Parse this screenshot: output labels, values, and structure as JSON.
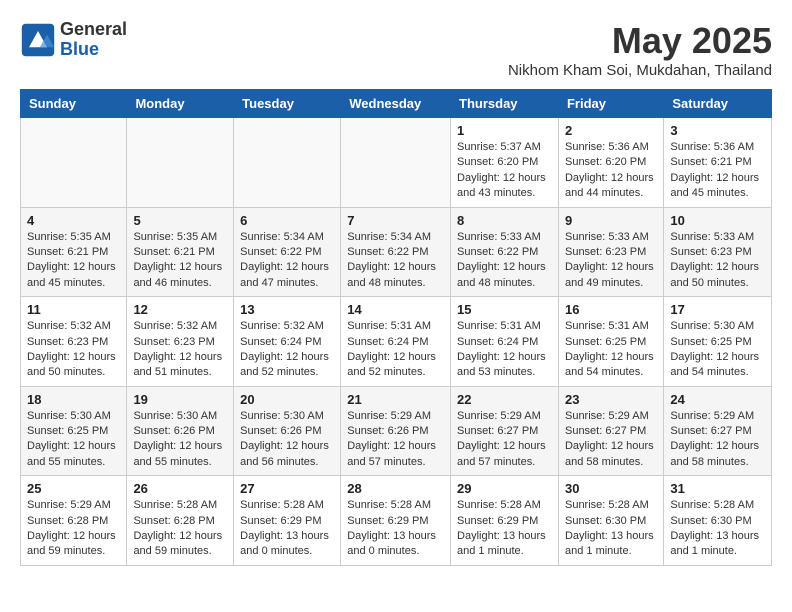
{
  "header": {
    "logo_general": "General",
    "logo_blue": "Blue",
    "month_year": "May 2025",
    "location": "Nikhom Kham Soi, Mukdahan, Thailand"
  },
  "days_of_week": [
    "Sunday",
    "Monday",
    "Tuesday",
    "Wednesday",
    "Thursday",
    "Friday",
    "Saturday"
  ],
  "weeks": [
    [
      {
        "day": "",
        "detail": ""
      },
      {
        "day": "",
        "detail": ""
      },
      {
        "day": "",
        "detail": ""
      },
      {
        "day": "",
        "detail": ""
      },
      {
        "day": "1",
        "detail": "Sunrise: 5:37 AM\nSunset: 6:20 PM\nDaylight: 12 hours\nand 43 minutes."
      },
      {
        "day": "2",
        "detail": "Sunrise: 5:36 AM\nSunset: 6:20 PM\nDaylight: 12 hours\nand 44 minutes."
      },
      {
        "day": "3",
        "detail": "Sunrise: 5:36 AM\nSunset: 6:21 PM\nDaylight: 12 hours\nand 45 minutes."
      }
    ],
    [
      {
        "day": "4",
        "detail": "Sunrise: 5:35 AM\nSunset: 6:21 PM\nDaylight: 12 hours\nand 45 minutes."
      },
      {
        "day": "5",
        "detail": "Sunrise: 5:35 AM\nSunset: 6:21 PM\nDaylight: 12 hours\nand 46 minutes."
      },
      {
        "day": "6",
        "detail": "Sunrise: 5:34 AM\nSunset: 6:22 PM\nDaylight: 12 hours\nand 47 minutes."
      },
      {
        "day": "7",
        "detail": "Sunrise: 5:34 AM\nSunset: 6:22 PM\nDaylight: 12 hours\nand 48 minutes."
      },
      {
        "day": "8",
        "detail": "Sunrise: 5:33 AM\nSunset: 6:22 PM\nDaylight: 12 hours\nand 48 minutes."
      },
      {
        "day": "9",
        "detail": "Sunrise: 5:33 AM\nSunset: 6:23 PM\nDaylight: 12 hours\nand 49 minutes."
      },
      {
        "day": "10",
        "detail": "Sunrise: 5:33 AM\nSunset: 6:23 PM\nDaylight: 12 hours\nand 50 minutes."
      }
    ],
    [
      {
        "day": "11",
        "detail": "Sunrise: 5:32 AM\nSunset: 6:23 PM\nDaylight: 12 hours\nand 50 minutes."
      },
      {
        "day": "12",
        "detail": "Sunrise: 5:32 AM\nSunset: 6:23 PM\nDaylight: 12 hours\nand 51 minutes."
      },
      {
        "day": "13",
        "detail": "Sunrise: 5:32 AM\nSunset: 6:24 PM\nDaylight: 12 hours\nand 52 minutes."
      },
      {
        "day": "14",
        "detail": "Sunrise: 5:31 AM\nSunset: 6:24 PM\nDaylight: 12 hours\nand 52 minutes."
      },
      {
        "day": "15",
        "detail": "Sunrise: 5:31 AM\nSunset: 6:24 PM\nDaylight: 12 hours\nand 53 minutes."
      },
      {
        "day": "16",
        "detail": "Sunrise: 5:31 AM\nSunset: 6:25 PM\nDaylight: 12 hours\nand 54 minutes."
      },
      {
        "day": "17",
        "detail": "Sunrise: 5:30 AM\nSunset: 6:25 PM\nDaylight: 12 hours\nand 54 minutes."
      }
    ],
    [
      {
        "day": "18",
        "detail": "Sunrise: 5:30 AM\nSunset: 6:25 PM\nDaylight: 12 hours\nand 55 minutes."
      },
      {
        "day": "19",
        "detail": "Sunrise: 5:30 AM\nSunset: 6:26 PM\nDaylight: 12 hours\nand 55 minutes."
      },
      {
        "day": "20",
        "detail": "Sunrise: 5:30 AM\nSunset: 6:26 PM\nDaylight: 12 hours\nand 56 minutes."
      },
      {
        "day": "21",
        "detail": "Sunrise: 5:29 AM\nSunset: 6:26 PM\nDaylight: 12 hours\nand 57 minutes."
      },
      {
        "day": "22",
        "detail": "Sunrise: 5:29 AM\nSunset: 6:27 PM\nDaylight: 12 hours\nand 57 minutes."
      },
      {
        "day": "23",
        "detail": "Sunrise: 5:29 AM\nSunset: 6:27 PM\nDaylight: 12 hours\nand 58 minutes."
      },
      {
        "day": "24",
        "detail": "Sunrise: 5:29 AM\nSunset: 6:27 PM\nDaylight: 12 hours\nand 58 minutes."
      }
    ],
    [
      {
        "day": "25",
        "detail": "Sunrise: 5:29 AM\nSunset: 6:28 PM\nDaylight: 12 hours\nand 59 minutes."
      },
      {
        "day": "26",
        "detail": "Sunrise: 5:28 AM\nSunset: 6:28 PM\nDaylight: 12 hours\nand 59 minutes."
      },
      {
        "day": "27",
        "detail": "Sunrise: 5:28 AM\nSunset: 6:29 PM\nDaylight: 13 hours\nand 0 minutes."
      },
      {
        "day": "28",
        "detail": "Sunrise: 5:28 AM\nSunset: 6:29 PM\nDaylight: 13 hours\nand 0 minutes."
      },
      {
        "day": "29",
        "detail": "Sunrise: 5:28 AM\nSunset: 6:29 PM\nDaylight: 13 hours\nand 1 minute."
      },
      {
        "day": "30",
        "detail": "Sunrise: 5:28 AM\nSunset: 6:30 PM\nDaylight: 13 hours\nand 1 minute."
      },
      {
        "day": "31",
        "detail": "Sunrise: 5:28 AM\nSunset: 6:30 PM\nDaylight: 13 hours\nand 1 minute."
      }
    ]
  ]
}
